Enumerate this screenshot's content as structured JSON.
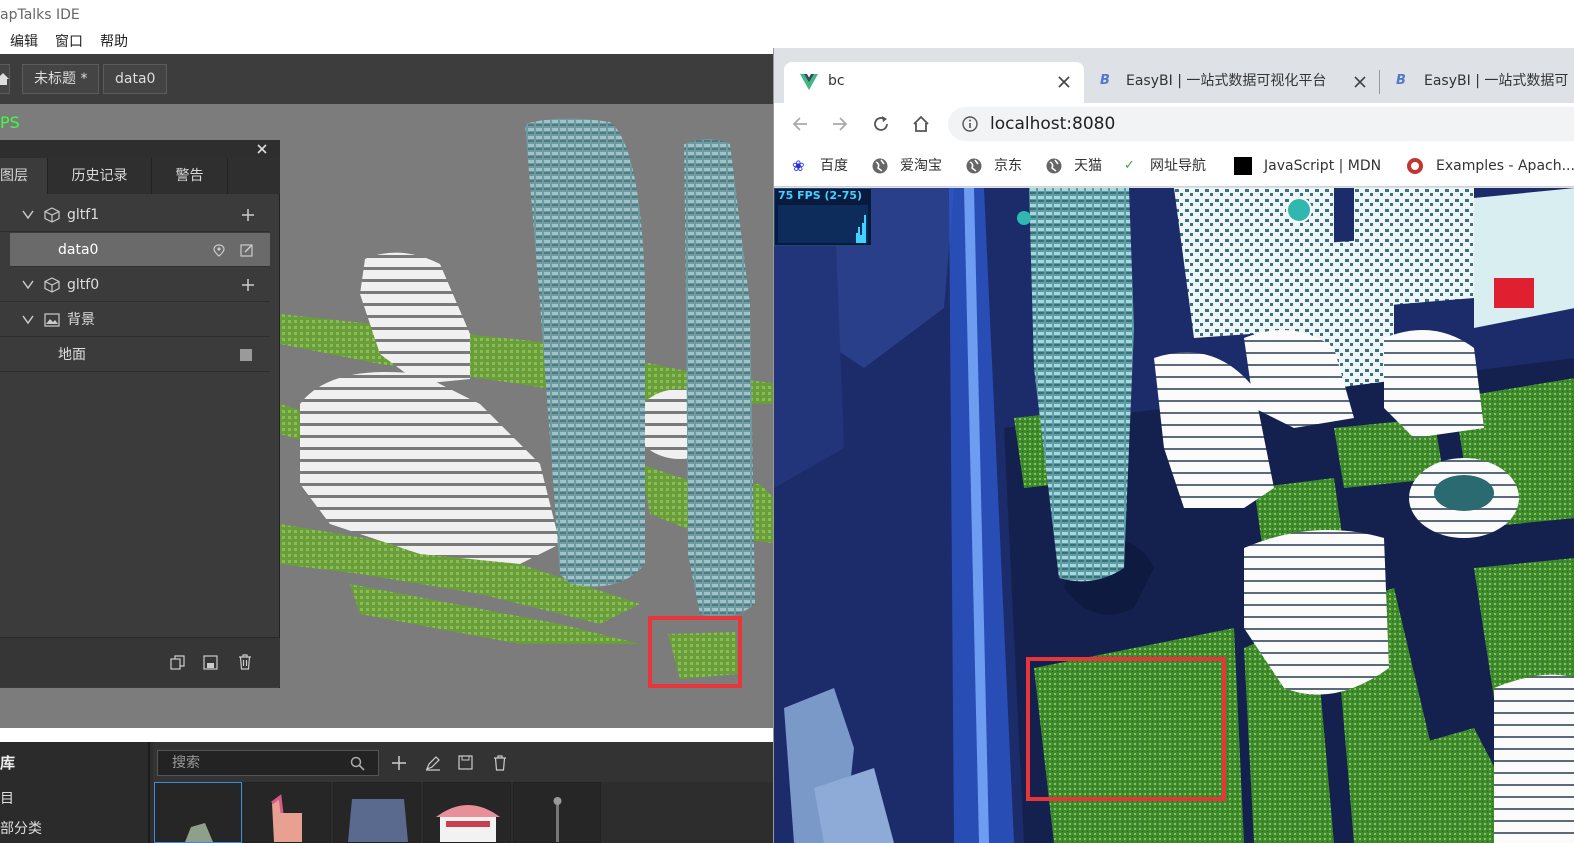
{
  "ide": {
    "title": "apTalks IDE",
    "menu": [
      "编辑",
      "窗口",
      "帮助"
    ],
    "doc_tabs": [
      "未标题 *",
      "data0"
    ],
    "fps": "PS",
    "panel": {
      "tabs": [
        "图层",
        "历史记录",
        "警告"
      ],
      "tree": [
        {
          "label": "gltf1",
          "icon": "cube-icon",
          "action": "add-icon"
        },
        {
          "label": "data0",
          "icon": "",
          "action": "locate-edit-icons"
        },
        {
          "label": "gltf0",
          "icon": "cube-icon",
          "action": "add-icon"
        },
        {
          "label": "背景",
          "icon": "image-icon",
          "action": ""
        },
        {
          "label": "地面",
          "icon": "",
          "action": "square-icon"
        }
      ]
    },
    "library": {
      "title": "库",
      "items": [
        "目",
        "部分类"
      ],
      "search_placeholder": "搜索"
    }
  },
  "browser": {
    "tabs": [
      {
        "title": "bc",
        "icon": "vue-icon"
      },
      {
        "title": "EasyBI | 一站式数据可视化平台",
        "icon": "easybi-icon"
      },
      {
        "title": "EasyBI | 一站式数据可",
        "icon": "easybi-icon"
      }
    ],
    "url": "localhost:8080",
    "bookmarks": [
      "百度",
      "爱淘宝",
      "京东",
      "天猫",
      "网址导航",
      "JavaScript | MDN",
      "Examples - Apach..."
    ],
    "stats_label": "75 FPS (2-75)"
  },
  "colors": {
    "highlight_box": "#e8353a",
    "fps_green": "#3dff3d",
    "ide_dark": "#3b3b3b",
    "city_blue": "#1a2a66"
  }
}
